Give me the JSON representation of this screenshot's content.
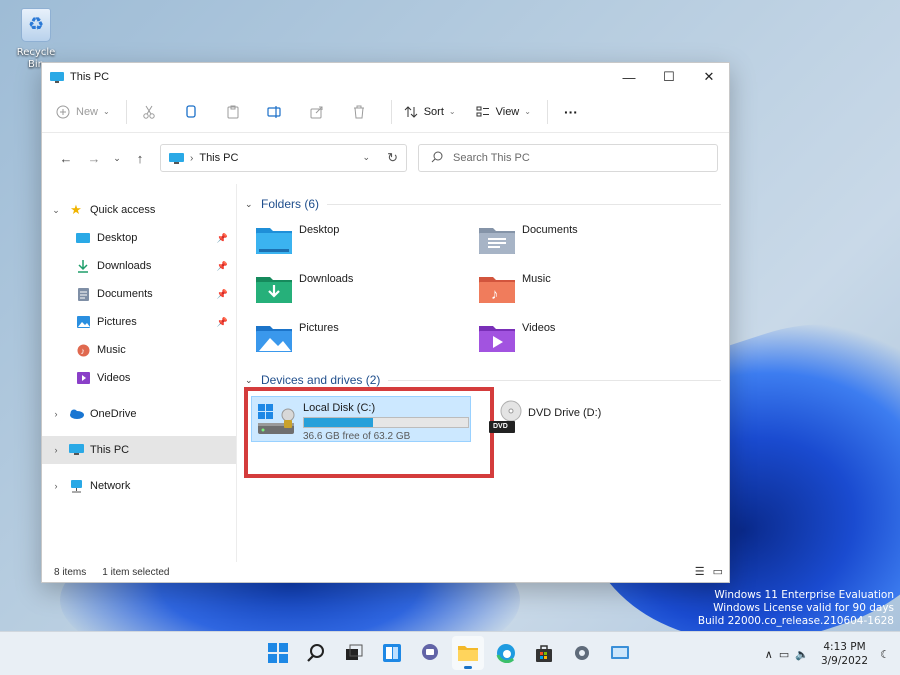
{
  "desktop": {
    "recycle_bin_label": "Recycle Bin",
    "watermark": [
      "Windows 11 Enterprise Evaluation",
      "Windows License valid for 90 days",
      "Build 22000.co_release.210604-1628"
    ]
  },
  "window": {
    "title": "This PC",
    "caption": {
      "minimize": "—",
      "maximize": "☐",
      "close": "✕"
    }
  },
  "toolbar": {
    "new_label": "New",
    "sort_label": "Sort",
    "view_label": "View",
    "more_label": "···"
  },
  "address": {
    "location": "This PC",
    "search_placeholder": "Search This PC"
  },
  "navpane": {
    "quick_access": "Quick access",
    "quick_items": [
      "Desktop",
      "Downloads",
      "Documents",
      "Pictures",
      "Music",
      "Videos"
    ],
    "onedrive": "OneDrive",
    "this_pc": "This PC",
    "network": "Network"
  },
  "content": {
    "folders_header": "Folders (6)",
    "folders": [
      "Desktop",
      "Documents",
      "Downloads",
      "Music",
      "Pictures",
      "Videos"
    ],
    "drives_header": "Devices and drives (2)",
    "drives": [
      {
        "name": "Local Disk (C:)",
        "free": "36.6 GB free of 63.2 GB",
        "used_fraction": 0.42
      },
      {
        "name": "DVD Drive (D:)"
      }
    ],
    "dvd_label": "DVD"
  },
  "statusbar": {
    "items": "8 items",
    "selected": "1 item selected"
  },
  "taskbar": {
    "time": "4:13 PM",
    "date": "3/9/2022"
  },
  "colors": {
    "accent": "#26a0da",
    "selection": "#cce8ff",
    "highlight_box": "#d43c3c"
  }
}
